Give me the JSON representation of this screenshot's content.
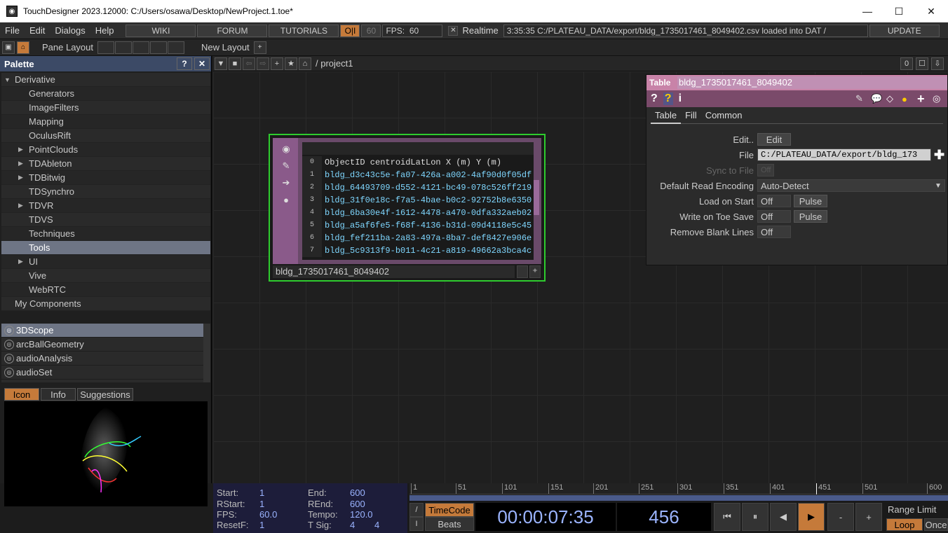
{
  "window": {
    "title": "TouchDesigner 2023.12000: C:/Users/osawa/Desktop/NewProject.1.toe*",
    "minimize": "—",
    "maximize": "☐",
    "close": "✕"
  },
  "menubar": {
    "items": [
      "File",
      "Edit",
      "Dialogs",
      "Help"
    ],
    "wiki": "WIKI",
    "forum": "FORUM",
    "tutorials": "TUTORIALS",
    "oi": "O|I",
    "fps_box": "60",
    "fps_label": "FPS:",
    "fps_value": "60",
    "realtime_check": "✕",
    "realtime": "Realtime",
    "status": "3:35:35 C:/PLATEAU_DATA/export/bldg_1735017461_8049402.csv loaded into DAT /",
    "update": "UPDATE"
  },
  "toolbar2": {
    "pane_layout": "Pane Layout",
    "new_layout": "New Layout",
    "add": "+"
  },
  "palette": {
    "title": "Palette",
    "help": "?",
    "close": "✕",
    "tree": [
      {
        "label": "Derivative",
        "indent": 0,
        "arrow": "▼"
      },
      {
        "label": "Generators",
        "indent": 2,
        "arrow": ""
      },
      {
        "label": "ImageFilters",
        "indent": 2,
        "arrow": ""
      },
      {
        "label": "Mapping",
        "indent": 2,
        "arrow": ""
      },
      {
        "label": "OculusRift",
        "indent": 2,
        "arrow": ""
      },
      {
        "label": "PointClouds",
        "indent": 2,
        "arrow": "▶"
      },
      {
        "label": "TDAbleton",
        "indent": 2,
        "arrow": "▶"
      },
      {
        "label": "TDBitwig",
        "indent": 2,
        "arrow": "▶"
      },
      {
        "label": "TDSynchro",
        "indent": 2,
        "arrow": ""
      },
      {
        "label": "TDVR",
        "indent": 2,
        "arrow": "▶"
      },
      {
        "label": "TDVS",
        "indent": 2,
        "arrow": ""
      },
      {
        "label": "Techniques",
        "indent": 2,
        "arrow": ""
      },
      {
        "label": "Tools",
        "indent": 2,
        "arrow": ""
      },
      {
        "label": "UI",
        "indent": 2,
        "arrow": "▶"
      },
      {
        "label": "Vive",
        "indent": 2,
        "arrow": ""
      },
      {
        "label": "WebRTC",
        "indent": 2,
        "arrow": ""
      },
      {
        "label": "My Components",
        "indent": 1,
        "arrow": ""
      }
    ],
    "selected": "Tools",
    "components": [
      "3DScope",
      "arcBallGeometry",
      "audioAnalysis",
      "audioSet"
    ],
    "selected_component": "3DScope",
    "tabs": [
      "Icon",
      "Info",
      "Suggestions"
    ],
    "active_tab": "Icon"
  },
  "network": {
    "path": "/ project1",
    "count": "0",
    "node": {
      "name": "bldg_1735017461_8049402",
      "header_cells": [
        "ObjectID",
        "centroidLatLon",
        "X (m)",
        "Y (m)"
      ],
      "rows": [
        {
          "n": "0",
          "v": "ObjectID    centroidLatLon  X (m)   Y (m)"
        },
        {
          "n": "1",
          "v": "bldg_d3c43c5e-fa07-426a-a002-4af90d0f05df"
        },
        {
          "n": "2",
          "v": "bldg_64493709-d552-4121-bc49-078c526ff219"
        },
        {
          "n": "3",
          "v": "bldg_31f0e18c-f7a5-4bae-b0c2-92752b8e6350"
        },
        {
          "n": "4",
          "v": "bldg_6ba30e4f-1612-4478-a470-0dfa332aeb02"
        },
        {
          "n": "5",
          "v": "bldg_a5af6fe5-f68f-4136-b31d-09d4118e5c45"
        },
        {
          "n": "6",
          "v": "bldg_fef211ba-2a83-497a-8ba7-def8427e906e"
        },
        {
          "n": "7",
          "v": "bldg_5c9313f9-b011-4c21-a819-49662a3bca4c"
        }
      ]
    }
  },
  "params": {
    "type": "Table",
    "name": "bldg_1735017461_8049402",
    "tabs": [
      "Table",
      "Fill",
      "Common"
    ],
    "active_tab": "Table",
    "rows": [
      {
        "label": "Edit..",
        "value": "Edit",
        "kind": "button"
      },
      {
        "label": "File",
        "value": "C:/PLATEAU_DATA/export/bldg_173",
        "kind": "field"
      },
      {
        "label": "Sync to File",
        "value": "Off",
        "kind": "dim"
      },
      {
        "label": "Default Read Encoding",
        "value": "Auto-Detect",
        "kind": "menu"
      },
      {
        "label": "Load on Start",
        "value": "Off",
        "pulse": "Pulse",
        "kind": "toggle"
      },
      {
        "label": "Write on Toe Save",
        "value": "Off",
        "pulse": "Pulse",
        "kind": "toggle"
      },
      {
        "label": "Remove Blank Lines",
        "value": "Off",
        "kind": "toggle"
      }
    ]
  },
  "timeline": {
    "start_label": "Start:",
    "start": "1",
    "end_label": "End:",
    "end": "600",
    "rstart_label": "RStart:",
    "rstart": "1",
    "rend_label": "REnd:",
    "rend": "600",
    "fps_label": "FPS:",
    "fps": "60.0",
    "tempo_label": "Tempo:",
    "tempo": "120.0",
    "resetf_label": "ResetF:",
    "resetf": "1",
    "tsig_label": "T Sig:",
    "tsig1": "4",
    "tsig2": "4",
    "ticks": [
      "1",
      "51",
      "101",
      "151",
      "201",
      "251",
      "301",
      "351",
      "401",
      "451",
      "501",
      "600"
    ],
    "timecode_btn": "TimeCode",
    "beats_btn": "Beats",
    "timecode": "00:00:07:35",
    "frame": "456",
    "range_limit": "Range Limit",
    "loop": "Loop",
    "once": "Once",
    "minus": "-",
    "plus": "+"
  },
  "colors": {
    "accent": "#c57a3a",
    "node_border": "#2ecc2e",
    "param_header": "#c883a8",
    "value_text": "#9bb4ff"
  }
}
